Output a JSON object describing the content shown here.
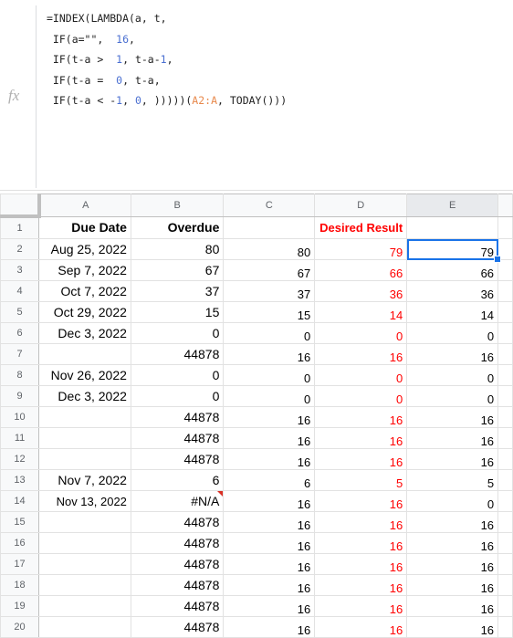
{
  "formula_bar": {
    "fx_label": "fx",
    "lines": [
      [
        {
          "t": "=INDEX(LAMBDA(a, t,",
          "c": ""
        }
      ],
      [
        {
          "t": " IF(a=\"\",  ",
          "c": ""
        },
        {
          "t": "16",
          "c": "num"
        },
        {
          "t": ",",
          "c": ""
        }
      ],
      [
        {
          "t": " IF(t-a >  ",
          "c": ""
        },
        {
          "t": "1",
          "c": "num"
        },
        {
          "t": ", t-a-",
          "c": ""
        },
        {
          "t": "1",
          "c": "num"
        },
        {
          "t": ",",
          "c": ""
        }
      ],
      [
        {
          "t": " IF(t-a =  ",
          "c": ""
        },
        {
          "t": "0",
          "c": "num"
        },
        {
          "t": ", t-a,",
          "c": ""
        }
      ],
      [
        {
          "t": " IF(t-a < -",
          "c": ""
        },
        {
          "t": "1",
          "c": "num"
        },
        {
          "t": ", ",
          "c": ""
        },
        {
          "t": "0",
          "c": "num"
        },
        {
          "t": ", )))))(",
          "c": ""
        },
        {
          "t": "A2:A",
          "c": "ref"
        },
        {
          "t": ", TODAY()))",
          "c": ""
        }
      ]
    ]
  },
  "sheet": {
    "columns": [
      "A",
      "B",
      "C",
      "D",
      "E"
    ],
    "active_column": "E",
    "selected_cell": "E2",
    "headers": {
      "A": "Due Date",
      "B": "Overdue",
      "C": "",
      "D": "Desired Result",
      "E": ""
    },
    "rows": [
      {
        "n": "2",
        "A": "Aug 25, 2022",
        "B": "80",
        "C": "80",
        "D": "79",
        "E": "79"
      },
      {
        "n": "3",
        "A": "Sep 7, 2022",
        "B": "67",
        "C": "67",
        "D": "66",
        "E": "66"
      },
      {
        "n": "4",
        "A": "Oct 7, 2022",
        "B": "37",
        "C": "37",
        "D": "36",
        "E": "36"
      },
      {
        "n": "5",
        "A": "Oct 29, 2022",
        "B": "15",
        "C": "15",
        "D": "14",
        "E": "14"
      },
      {
        "n": "6",
        "A": "Dec 3, 2022",
        "B": "0",
        "C": "0",
        "D": "0",
        "E": "0"
      },
      {
        "n": "7",
        "A": "",
        "B": "44878",
        "C": "16",
        "D": "16",
        "E": "16"
      },
      {
        "n": "8",
        "A": "Nov 26, 2022",
        "B": "0",
        "C": "0",
        "D": "0",
        "E": "0"
      },
      {
        "n": "9",
        "A": "Dec 3, 2022",
        "B": "0",
        "C": "0",
        "D": "0",
        "E": "0"
      },
      {
        "n": "10",
        "A": "",
        "B": "44878",
        "C": "16",
        "D": "16",
        "E": "16"
      },
      {
        "n": "11",
        "A": "",
        "B": "44878",
        "C": "16",
        "D": "16",
        "E": "16"
      },
      {
        "n": "12",
        "A": "",
        "B": "44878",
        "C": "16",
        "D": "16",
        "E": "16"
      },
      {
        "n": "13",
        "A": "Nov 7, 2022",
        "B": "6",
        "C": "6",
        "D": "5",
        "E": "5"
      },
      {
        "n": "14",
        "A": "Nov 13, 2022",
        "B": "#N/A",
        "C": "16",
        "D": "16",
        "E": "0",
        "B_error": true
      },
      {
        "n": "15",
        "A": "",
        "B": "44878",
        "C": "16",
        "D": "16",
        "E": "16"
      },
      {
        "n": "16",
        "A": "",
        "B": "44878",
        "C": "16",
        "D": "16",
        "E": "16"
      },
      {
        "n": "17",
        "A": "",
        "B": "44878",
        "C": "16",
        "D": "16",
        "E": "16"
      },
      {
        "n": "18",
        "A": "",
        "B": "44878",
        "C": "16",
        "D": "16",
        "E": "16"
      },
      {
        "n": "19",
        "A": "",
        "B": "44878",
        "C": "16",
        "D": "16",
        "E": "16"
      },
      {
        "n": "20",
        "A": "",
        "B": "44878",
        "C": "16",
        "D": "16",
        "E": "16"
      }
    ]
  }
}
